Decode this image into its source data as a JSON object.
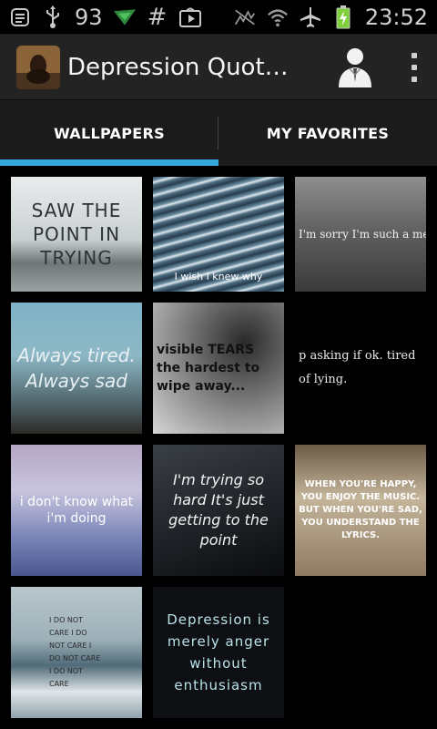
{
  "status_bar": {
    "battery_badge": "93",
    "time": "23:52",
    "left_icons": [
      "notification-icon",
      "usb-icon",
      "battery-badge",
      "app-notification-icon",
      "hash-icon",
      "play-store-icon"
    ],
    "right_icons": [
      "signal-muted-icon",
      "wifi-icon",
      "airplane-icon",
      "battery-charging-icon"
    ]
  },
  "action_bar": {
    "title": "Depression Quot…",
    "person_icon": "contact-icon",
    "overflow_icon": "overflow-menu-icon"
  },
  "tabs": [
    {
      "label": "WALLPAPERS",
      "selected": true
    },
    {
      "label": "MY FAVORITES",
      "selected": false
    }
  ],
  "wallpapers": [
    {
      "text": "SAW THE POINT IN TRYING"
    },
    {
      "text": "I wish I knew why"
    },
    {
      "text": "I'm sorry I'm such a mess"
    },
    {
      "text": "Always tired. Always sad"
    },
    {
      "text": "visible TEARS the hardest to wipe away..."
    },
    {
      "text": "p asking if ok. tired of lying."
    },
    {
      "text": "i don't know what i'm doing"
    },
    {
      "text": "I'm trying so hard It's just getting to the point"
    },
    {
      "text": "WHEN YOU'RE HAPPY, YOU ENJOY THE MUSIC. BUT WHEN YOU'RE SAD, YOU UNDERSTAND THE LYRICS."
    },
    {
      "text": "I DO NOT CARE I DO NOT CARE I DO NOT CARE I DO NOT CARE"
    },
    {
      "text": "Depression is merely anger without enthusiasm"
    }
  ],
  "colors": {
    "accent": "#35a8da",
    "action_bar": "#232323",
    "tab_bar": "#1b1b1b",
    "background": "#000000"
  }
}
